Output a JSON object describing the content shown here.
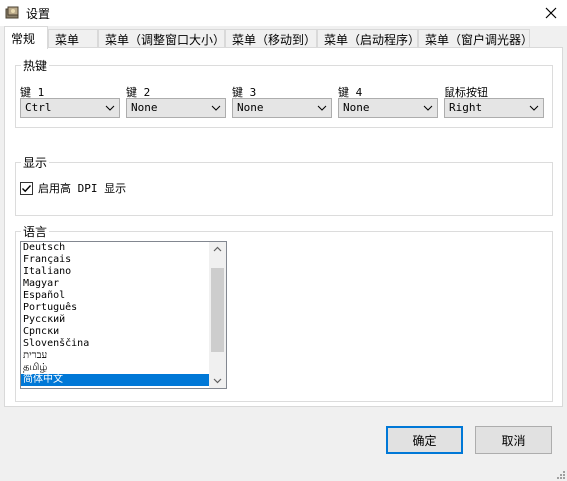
{
  "window": {
    "title": "设置"
  },
  "tabs": [
    {
      "label": "常规"
    },
    {
      "label": "菜单"
    },
    {
      "label": "菜单（调整窗口大小）"
    },
    {
      "label": "菜单（移动到）"
    },
    {
      "label": "菜单（启动程序）"
    },
    {
      "label": "菜单（窗户调光器）"
    }
  ],
  "hotkeys": {
    "group_label": "热键",
    "key1": {
      "label": "键 1",
      "value": "Ctrl"
    },
    "key2": {
      "label": "键 2",
      "value": "None"
    },
    "key3": {
      "label": "键 3",
      "value": "None"
    },
    "key4": {
      "label": "键 4",
      "value": "None"
    },
    "mouse": {
      "label": "鼠标按钮",
      "value": "Right"
    }
  },
  "display": {
    "group_label": "显示",
    "high_dpi": {
      "label": "启用高 DPI 显示",
      "checked": true
    }
  },
  "language": {
    "group_label": "语言",
    "items": [
      "Deutsch",
      "Français",
      "Italiano",
      "Magyar",
      "Español",
      "Português",
      "Русский",
      "Српски",
      "Slovenščina",
      "עברית",
      "தமிழ்",
      "简体中文"
    ],
    "selected": "简体中文"
  },
  "buttons": {
    "ok": "确定",
    "cancel": "取消"
  },
  "colors": {
    "accent": "#0078d7",
    "panel_bg": "#ffffff",
    "window_bg": "#f0f0f0"
  }
}
